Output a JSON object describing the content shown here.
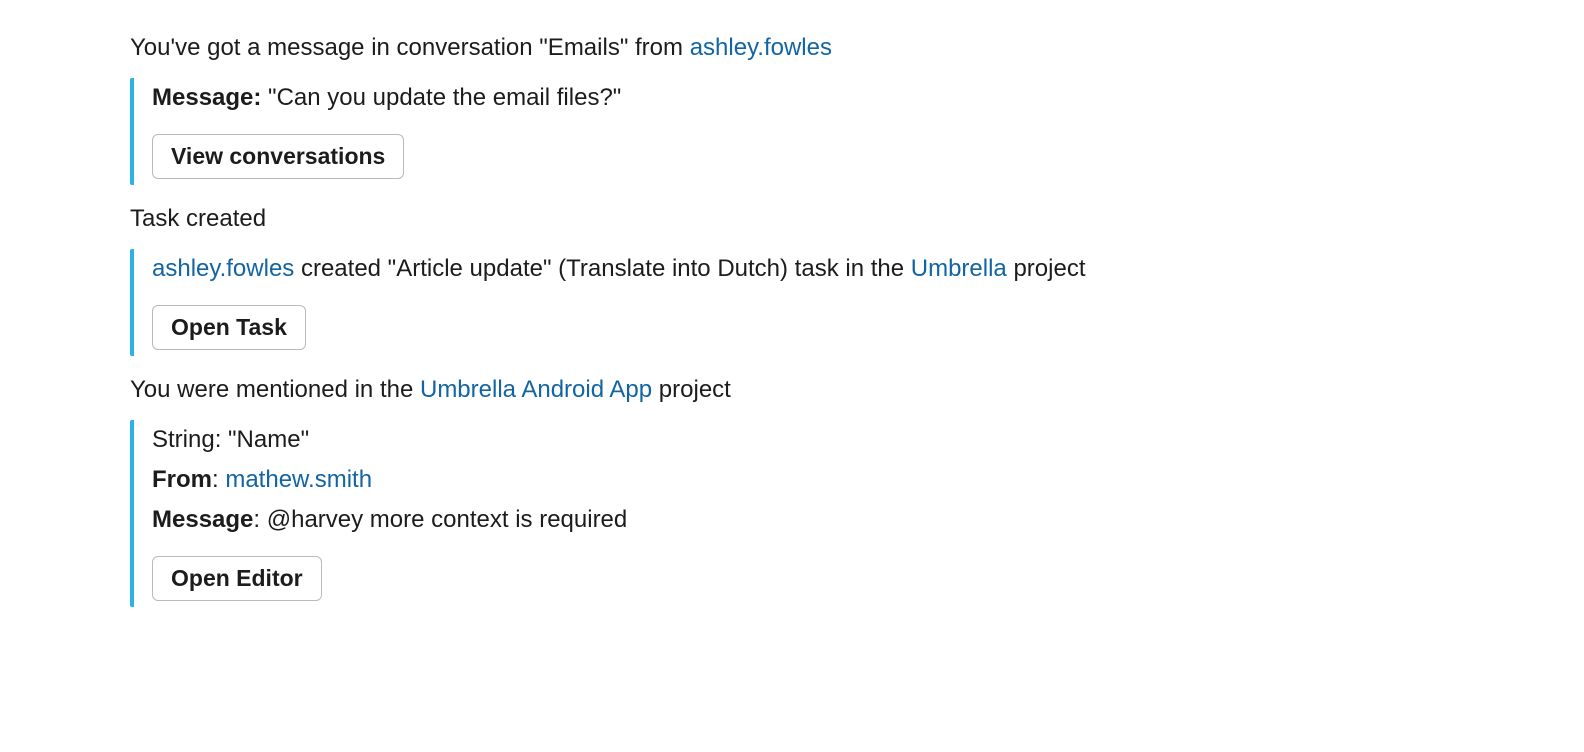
{
  "n1": {
    "header_prefix": "You've got a message in conversation \"Emails\" from ",
    "header_user": "ashley.fowles",
    "message_label": "Message:",
    "message_text": " \"Can you update the email files?\"",
    "button_label": "View conversations"
  },
  "n2": {
    "header": "Task created",
    "user": "ashley.fowles",
    "mid_text": " created \"Article update\" (Translate into Dutch) task in the ",
    "project": "Umbrella",
    "suffix": " project",
    "button_label": "Open Task"
  },
  "n3": {
    "header_prefix": "You were mentioned in the ",
    "project": "Umbrella Android App",
    "header_suffix": " project",
    "string_label": "String: ",
    "string_value": "\"Name\"",
    "from_label": "From",
    "from_sep": ": ",
    "from_user": "mathew.smith",
    "message_label": "Message",
    "message_sep": ": ",
    "message_text": "@harvey more context is required",
    "button_label": "Open Editor"
  }
}
